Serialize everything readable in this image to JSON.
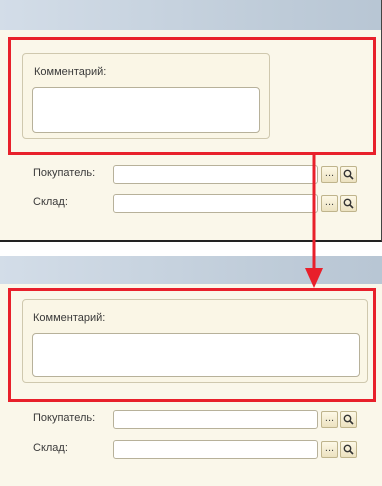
{
  "comment_label": "Комментарий:",
  "buyer_label": "Покупатель:",
  "warehouse_label": "Склад:",
  "select_button_label": "...",
  "icons": [
    "search-icon",
    "arrow-down-icon"
  ],
  "colors": {
    "highlight": "#e8202b",
    "panel_bg": "#faf7ea",
    "title_bar": "#c4d0dc"
  }
}
